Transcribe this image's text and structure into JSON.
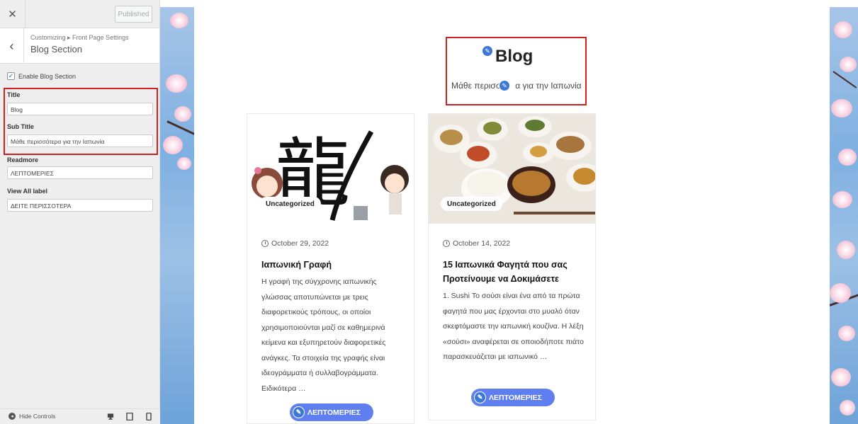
{
  "customizer": {
    "published_label": "Published",
    "breadcrumb": "Customizing ▸ Front Page Settings",
    "section_title": "Blog Section",
    "enable_label": "Enable Blog Section",
    "fields": {
      "title_label": "Title",
      "title_value": "Blog",
      "subtitle_label": "Sub Title",
      "subtitle_value": "Μάθε περισσότερα για την Ιαπωνία",
      "readmore_label": "Readmore",
      "readmore_value": "ΛΕΠΤΟΜΕΡΙΕΣ",
      "viewall_label": "View All label",
      "viewall_value": "ΔΕΙΤΕ ΠΕΡΙΣΣΟΤΕΡΑ"
    },
    "hide_controls_label": "Hide Controls",
    "icons": {
      "close": "close-icon",
      "back": "chevron-left-icon",
      "desktop": "desktop-icon",
      "tablet": "tablet-icon",
      "mobile": "mobile-icon"
    }
  },
  "preview": {
    "blog_title": "Blog",
    "blog_subtitle_left": "Μάθε περισσ",
    "blog_subtitle_right": "α για την Ιαπωνία",
    "posts": [
      {
        "category": "Uncategorized",
        "date": "October 29, 2022",
        "title": "Ιαπωνική Γραφή",
        "excerpt": "Η γραφή της σύγχρονης ιαπωνικής γλώσσας αποτυπώνεται με τρεις διαφορετικούς τρόπους, οι οποίοι χρησιμοποιούνται μαζί σε καθημερινά κείμενα και εξυπηρετούν διαφορετικές ανάγκες. Τα στοιχεία της γραφής είναι ιδεογράμματα ή συλλαβογράμματα. Ειδικότερα …",
        "button": "ΛΕΠΤΟΜΕΡΙΕΣ",
        "image_kanji": "龍"
      },
      {
        "category": "Uncategorized",
        "date": "October 14, 2022",
        "title": "15 Ιαπωνικά Φαγητά που σας Προτείνουμε να Δοκιμάσετε",
        "excerpt": "1. Sushi Το σούσι είναι ένα από τα πρώτα φαγητά που μας έρχονται στο μυαλό όταν σκεφτόμαστε την ιαπωνική κουζίνα.  Η λέξη «σούσι» αναφέρεται σε οποιοδήποτε πιάτο παρασκευάζεται με ιαπωνικό …",
        "button": "ΛΕΠΤΟΜΕΡΙΕΣ"
      }
    ]
  },
  "colors": {
    "highlight_red": "#d21f1f",
    "button_blue": "#5f7ff0",
    "pencil_blue": "#3c78d8"
  }
}
